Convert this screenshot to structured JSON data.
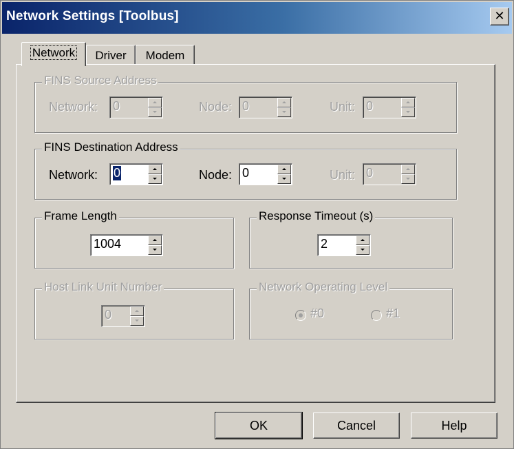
{
  "window": {
    "title": "Network Settings [Toolbus]",
    "close_glyph": "✕"
  },
  "tabs": [
    {
      "label": "Network",
      "active": true
    },
    {
      "label": "Driver",
      "active": false
    },
    {
      "label": "Modem",
      "active": false
    }
  ],
  "fins_source": {
    "title": "FINS Source Address",
    "enabled": false,
    "network": {
      "label": "Network:",
      "value": "0"
    },
    "node": {
      "label": "Node:",
      "value": "0"
    },
    "unit": {
      "label": "Unit:",
      "value": "0"
    }
  },
  "fins_destination": {
    "title": "FINS Destination Address",
    "enabled": true,
    "network": {
      "label": "Network:",
      "value": "0"
    },
    "node": {
      "label": "Node:",
      "value": "0"
    },
    "unit": {
      "label": "Unit:",
      "value": "0",
      "enabled": false
    }
  },
  "frame_length": {
    "title": "Frame Length",
    "value": "1004"
  },
  "response_timeout": {
    "title": "Response Timeout (s)",
    "value": "2"
  },
  "host_link": {
    "title": "Host Link Unit Number",
    "value": "0",
    "enabled": false
  },
  "network_level": {
    "title": "Network Operating Level",
    "enabled": false,
    "options": [
      {
        "label": "#0",
        "checked": true
      },
      {
        "label": "#1",
        "checked": false
      }
    ]
  },
  "buttons": {
    "ok": "OK",
    "cancel": "Cancel",
    "help": "Help"
  },
  "colors": {
    "face": "#d4d0c8",
    "title_start": "#0a246a",
    "title_end": "#a6caf0",
    "disabled_text": "#a0a0a0"
  }
}
